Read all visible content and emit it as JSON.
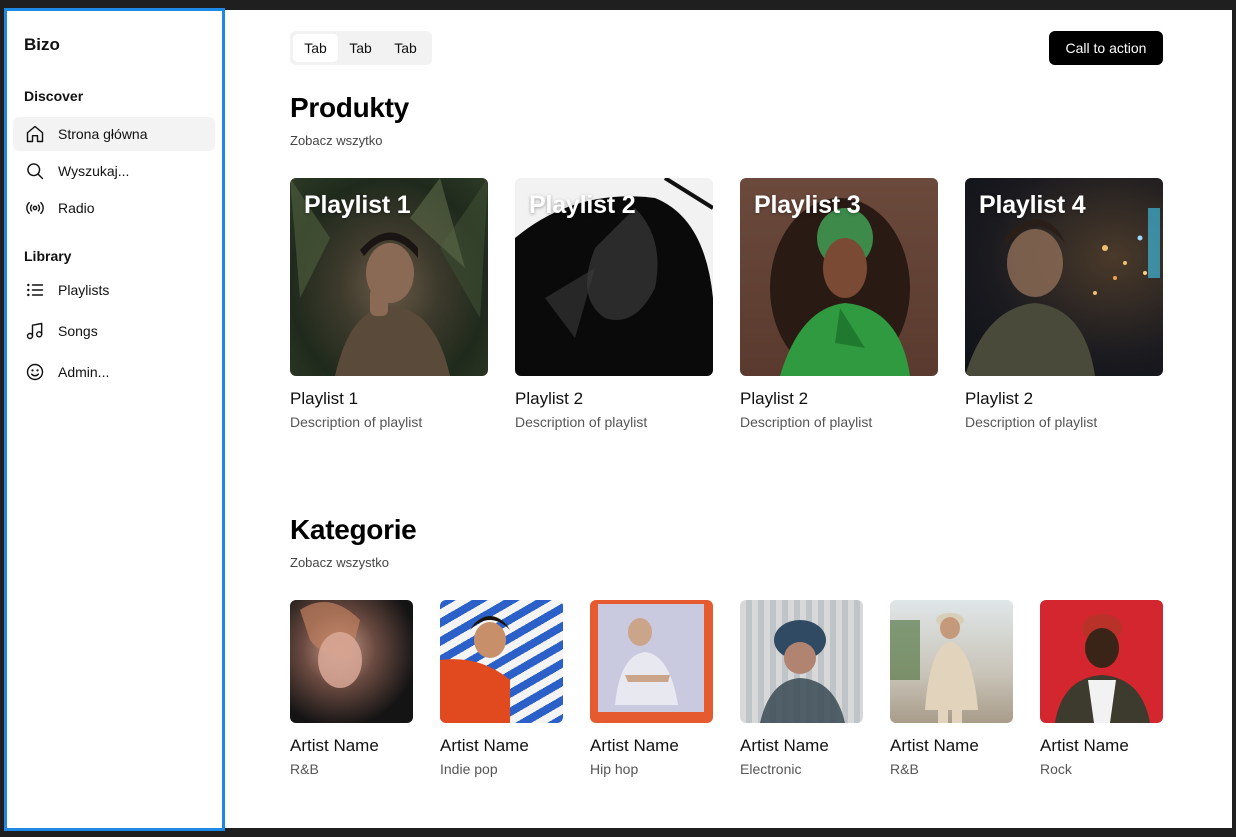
{
  "sidebar": {
    "brand": "Bizo",
    "discover_title": "Discover",
    "discover_items": [
      {
        "label": "Strona główna",
        "icon": "home-icon"
      },
      {
        "label": "Wyszukaj...",
        "icon": "search-icon"
      },
      {
        "label": "Radio",
        "icon": "radio-icon"
      }
    ],
    "library_title": "Library",
    "library_items": [
      {
        "label": "Playlists",
        "icon": "list-icon"
      },
      {
        "label": "Songs",
        "icon": "music-note-icon"
      },
      {
        "label": "Admin...",
        "icon": "smiley-icon"
      }
    ]
  },
  "header": {
    "tabs": [
      "Tab",
      "Tab",
      "Tab"
    ],
    "cta_label": "Call to action"
  },
  "products": {
    "title": "Produkty",
    "see_all": "Zobacz wszytko",
    "items": [
      {
        "overlay": "Playlist 1",
        "title": "Playlist 1",
        "description": "Description of playlist"
      },
      {
        "overlay": "Playlist 2",
        "title": "Playlist 2",
        "description": "Description of playlist"
      },
      {
        "overlay": "Playlist 3",
        "title": "Playlist 2",
        "description": "Description of playlist"
      },
      {
        "overlay": "Playlist 4",
        "title": "Playlist 2",
        "description": "Description of playlist"
      }
    ]
  },
  "categories": {
    "title": "Kategorie",
    "see_all": "Zobacz wszystko",
    "items": [
      {
        "name": "Artist Name",
        "genre": "R&B"
      },
      {
        "name": "Artist Name",
        "genre": "Indie pop"
      },
      {
        "name": "Artist Name",
        "genre": "Hip hop"
      },
      {
        "name": "Artist Name",
        "genre": "Electronic"
      },
      {
        "name": "Artist Name",
        "genre": "R&B"
      },
      {
        "name": "Artist Name",
        "genre": "Rock"
      }
    ]
  },
  "colors": {
    "accent_border": "#1e88e5",
    "cta_bg": "#000000",
    "active_nav_bg": "#f3f3f3"
  }
}
